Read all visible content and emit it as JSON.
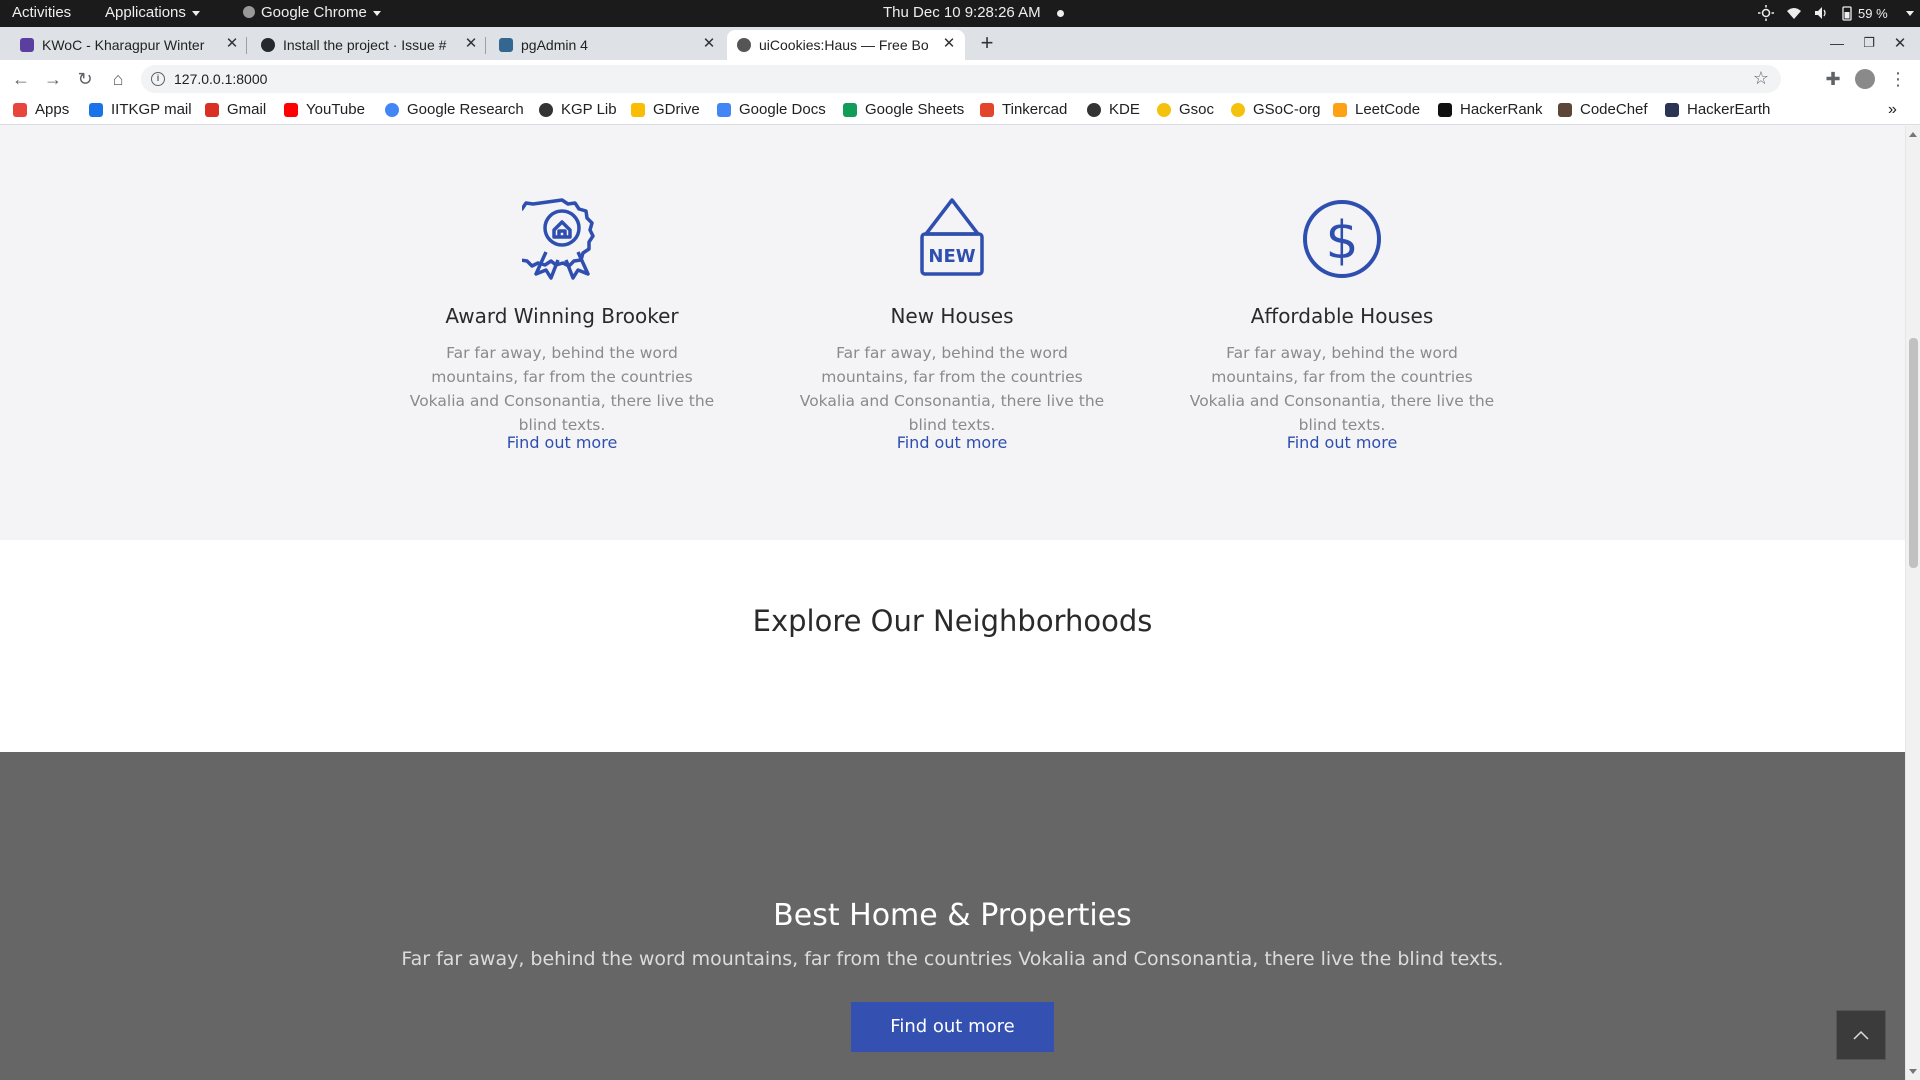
{
  "system_bar": {
    "activities": "Activities",
    "applications": "Applications",
    "browser_app": "Google Chrome",
    "datetime": "Thu Dec 10  9:28:26 AM",
    "battery": "59 %"
  },
  "tabs": [
    {
      "title": "KWoC - Kharagpur Winter",
      "color": "#5b3fa0",
      "active": false
    },
    {
      "title": "Install the project · Issue #",
      "color": "#24292e",
      "active": false
    },
    {
      "title": "pgAdmin 4",
      "color": "#336791",
      "active": false
    },
    {
      "title": "uiCookies:Haus — Free Bo",
      "color": "#555555",
      "active": true
    }
  ],
  "address_bar": {
    "url": "127.0.0.1:8000"
  },
  "bookmarks": [
    {
      "label": "Apps",
      "color": "#e8453c"
    },
    {
      "label": "IITKGP mail",
      "color": "#1a73e8"
    },
    {
      "label": "Gmail",
      "color": "#d93025"
    },
    {
      "label": "YouTube",
      "color": "#ff0000"
    },
    {
      "label": "Google Research",
      "color": "#4285f4"
    },
    {
      "label": "KGP Lib",
      "color": "#333333"
    },
    {
      "label": "GDrive",
      "color": "#fbbc04"
    },
    {
      "label": "Google Docs",
      "color": "#4285f4"
    },
    {
      "label": "Google Sheets",
      "color": "#0f9d58"
    },
    {
      "label": "Tinkercad",
      "color": "#e2452c"
    },
    {
      "label": "KDE",
      "color": "#333333"
    },
    {
      "label": "Gsoc",
      "color": "#f4c20d"
    },
    {
      "label": "GSoC-org",
      "color": "#f4c20d"
    },
    {
      "label": "LeetCode",
      "color": "#ffa116"
    },
    {
      "label": "HackerRank",
      "color": "#111111"
    },
    {
      "label": "CodeChef",
      "color": "#5b4638"
    },
    {
      "label": "HackerEarth",
      "color": "#2c3454"
    }
  ],
  "features": [
    {
      "icon": "award-ribbon-icon",
      "title": "Award Winning Brooker",
      "text": "Far far away, behind the word mountains, far from the countries Vokalia and Consonantia, there live the blind texts.",
      "link": "Find out more"
    },
    {
      "icon": "new-sign-icon",
      "title": "New Houses",
      "text": "Far far away, behind the word mountains, far from the countries Vokalia and Consonantia, there live the blind texts.",
      "link": "Find out more"
    },
    {
      "icon": "dollar-icon",
      "title": "Affordable Houses",
      "text": "Far far away, behind the word mountains, far from the countries Vokalia and Consonantia, there live the blind texts.",
      "link": "Find out more"
    }
  ],
  "neighborhoods": {
    "title": "Explore Our Neighborhoods"
  },
  "best": {
    "title": "Best Home & Properties",
    "text": "Far far away, behind the word mountains, far from the countries Vokalia and Consonantia, there live the blind texts.",
    "button": "Find out more"
  },
  "colors": {
    "accent": "#3451b2",
    "icon_blue": "#2f4fb0",
    "dark_section": "#666667"
  }
}
